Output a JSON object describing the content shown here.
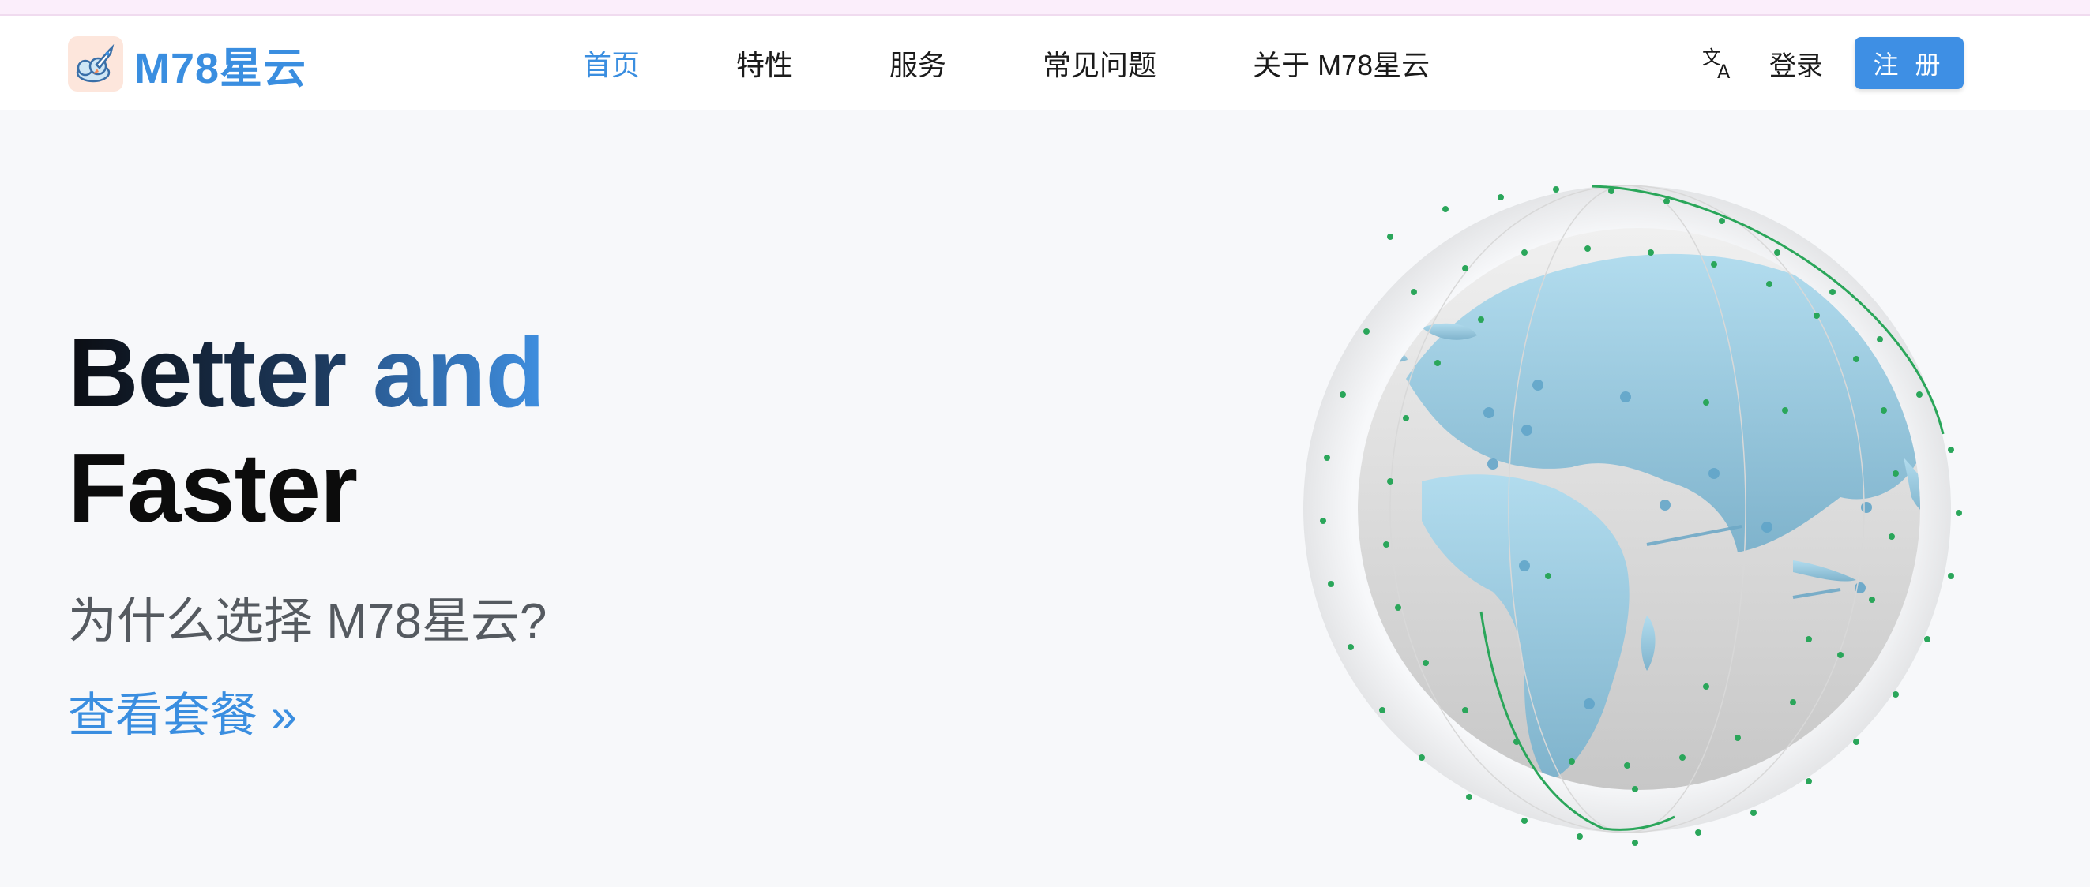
{
  "brand": {
    "name": "M78星云",
    "logo_icon": "rocket-cloud-icon"
  },
  "nav": {
    "items": [
      {
        "label": "首页",
        "active": true
      },
      {
        "label": "特性",
        "active": false
      },
      {
        "label": "服务",
        "active": false
      },
      {
        "label": "常见问题",
        "active": false
      },
      {
        "label": "关于 M78星云",
        "active": false
      }
    ],
    "language_icon": "translate-icon",
    "login_label": "登录",
    "signup_label": "注 册"
  },
  "hero": {
    "title_word1": "Better",
    "title_word2": "and",
    "title_word3": "Faster",
    "subtitle": "为什么选择 M78星云?",
    "cta_label": "查看套餐 »"
  },
  "illustration": {
    "icon": "globe-icon"
  },
  "colors": {
    "accent": "#3a8ee0",
    "button": "#3e8fe4",
    "background": "#f7f8fa",
    "navbar": "#ffffff",
    "orbit": "#2aa65a",
    "land": "#9fd0e6"
  }
}
